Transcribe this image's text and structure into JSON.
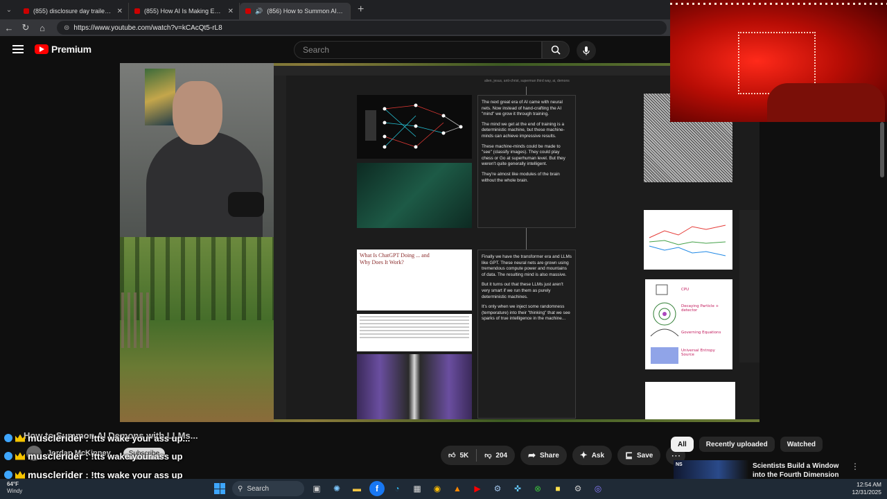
{
  "browser": {
    "tabs": [
      {
        "title": "(855) disclosure day trailer - YouTube",
        "active": false
      },
      {
        "title": "(855) How AI Is Making Everything",
        "active": false
      },
      {
        "title": "(856) How to Summon AI Demons",
        "active": true
      }
    ],
    "url": "https://www.youtube.com/watch?v=kCAcQt5-rL8"
  },
  "youtube": {
    "logo_text": "Premium",
    "search_placeholder": "Search"
  },
  "video_slide": {
    "crumb": "alien, jesus, anti-christ, superman third way, ai, demons",
    "card1": [
      "The next great era of AI came with neural nets. Now instead of hand-crafting the AI \"mind\" we grow it through training.",
      "The mind we get at the end of training is a deterministic machine, but these machine-minds can achieve impressive results.",
      "These machine-minds could be made to \"see\" (classify images). They could play chess or Go at superhuman level. But they weren't quite generally intelligent.",
      "They're almost like modules of the brain without the whole brain."
    ],
    "card2": [
      "Finally we have the transformer era and LLMs like GPT. These neural nets are grown using tremendous compute power and mountains of data. The resulting mind is also massive.",
      "But it turns out that these LLMs just aren't very smart if we run them as purely deterministic machines.",
      "It's only when we inject some randomness (temperature) into their \"thinking\" that we see sparks of true intelligence in the machine..."
    ],
    "article_title": "What Is ChatGPT Doing ... and Why Does It Work?",
    "sketch_labels": [
      "CPU",
      "Decaying Particle + detector",
      "Governing Equations",
      "Universal Entropy Source"
    ]
  },
  "below_video": {
    "title": "How to Summon AI Demons with LLMs...",
    "channel": "Jordan McKinney",
    "subscribe": "Subscribe",
    "actions": {
      "likes": "5K",
      "dislikes": "204",
      "share": "Share",
      "ask": "Ask",
      "save": "Save"
    }
  },
  "chat": [
    {
      "user": "musclerider",
      "message": ": !tts wake your ass up..."
    },
    {
      "user": "musclerider",
      "message": ": !tts wake your ass up"
    },
    {
      "user": "musclerider",
      "message": ": !tts wake your ass up"
    }
  ],
  "sidebar": {
    "chips": [
      "All",
      "Recently uploaded",
      "Watched"
    ],
    "recommendation": {
      "badge": "NS",
      "title": "Scientists Build a Window into the Fourth Dimension"
    }
  },
  "taskbar": {
    "weather_temp": "64°F",
    "weather_desc": "Windy",
    "search": "Search",
    "time": "12:54 AM",
    "date": "12/31/2025"
  }
}
